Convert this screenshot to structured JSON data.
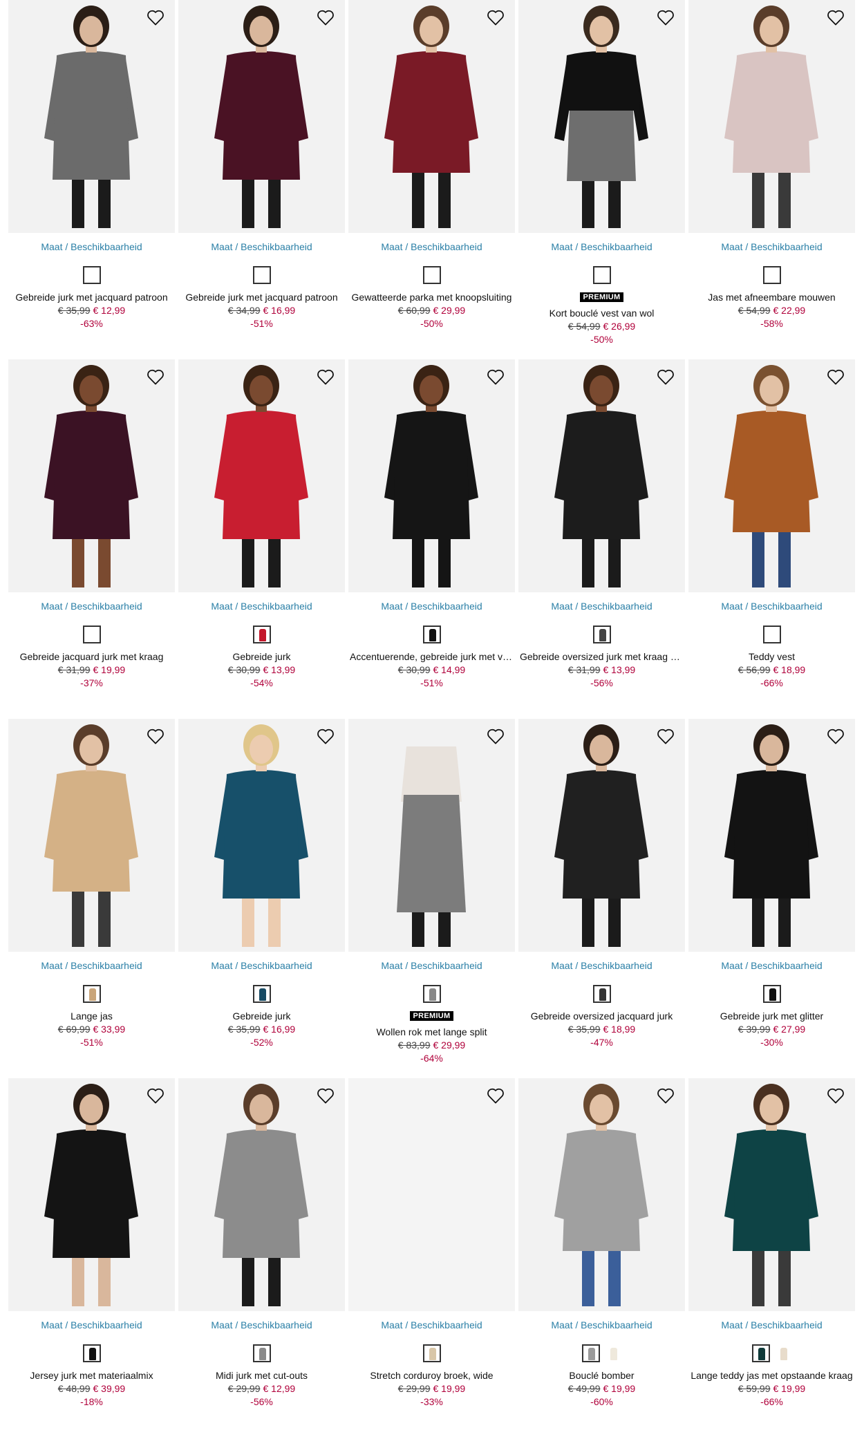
{
  "common": {
    "availability_label": "Maat / Beschikbaarheid"
  },
  "products": [
    {
      "name": "Gebreide jurk met jacquard patroon",
      "old_price": "€ 35,99",
      "new_price": "€ 12,99",
      "discount": "-63%",
      "badge": "",
      "colors": [
        "#ffffff"
      ],
      "figure": {
        "skin": "#d9b79c",
        "hair": "#2b1e16",
        "top": "#6b6b6b",
        "bottom": "#6b6b6b",
        "legs": "#1b1b1b",
        "bg": "#f2f2f2",
        "style": "dress"
      }
    },
    {
      "name": "Gebreide jurk met jacquard patroon",
      "old_price": "€ 34,99",
      "new_price": "€ 16,99",
      "discount": "-51%",
      "badge": "",
      "colors": [
        "#ffffff"
      ],
      "figure": {
        "skin": "#d9b79c",
        "hair": "#2b1e16",
        "top": "#4a1224",
        "bottom": "#4a1224",
        "legs": "#1b1b1b",
        "bg": "#f2f2f2",
        "style": "dress"
      }
    },
    {
      "name": "Gewatteerde parka met knoopsluiting",
      "old_price": "€ 60,99",
      "new_price": "€ 29,99",
      "discount": "-50%",
      "badge": "",
      "colors": [
        "#ffffff"
      ],
      "figure": {
        "skin": "#e2c1a5",
        "hair": "#5a3d2a",
        "top": "#7a1a26",
        "bottom": "#7a1a26",
        "legs": "#1b1b1b",
        "bg": "#f2f2f2",
        "style": "coat"
      }
    },
    {
      "name": "Kort bouclé vest van wol",
      "old_price": "€ 54,99",
      "new_price": "€ 26,99",
      "discount": "-50%",
      "badge": "PREMIUM",
      "colors": [
        "#ffffff"
      ],
      "figure": {
        "skin": "#e2c1a5",
        "hair": "#3a2a1e",
        "top": "#111111",
        "bottom": "#6e6e6e",
        "legs": "#1b1b1b",
        "bg": "#f2f2f2",
        "style": "top"
      }
    },
    {
      "name": "Jas met afneembare mouwen",
      "old_price": "€ 54,99",
      "new_price": "€ 22,99",
      "discount": "-58%",
      "badge": "",
      "colors": [
        "#ffffff"
      ],
      "figure": {
        "skin": "#e2c1a5",
        "hair": "#5a3d2a",
        "top": "#d9c4c2",
        "bottom": "#d9c4c2",
        "legs": "#3a3a3a",
        "bg": "#f2f2f2",
        "style": "coat"
      }
    },
    {
      "name": "Gebreide jacquard jurk met kraag",
      "old_price": "€ 31,99",
      "new_price": "€ 19,99",
      "discount": "-37%",
      "badge": "",
      "colors": [
        "#ffffff"
      ],
      "figure": {
        "skin": "#7a4a30",
        "hair": "#3a2314",
        "top": "#3b1224",
        "bottom": "#3b1224",
        "legs": "#7a4a30",
        "bg": "#f2f2f2",
        "style": "dress"
      }
    },
    {
      "name": "Gebreide jurk",
      "old_price": "€ 30,99",
      "new_price": "€ 13,99",
      "discount": "-54%",
      "badge": "",
      "colors": [
        "#c3162a"
      ],
      "figure": {
        "skin": "#7a4a30",
        "hair": "#3a2314",
        "top": "#c81e30",
        "bottom": "#c81e30",
        "legs": "#1b1b1b",
        "bg": "#f2f2f2",
        "style": "dress"
      }
    },
    {
      "name": "Accentuerende, gebreide jurk met veters",
      "old_price": "€ 30,99",
      "new_price": "€ 14,99",
      "discount": "-51%",
      "badge": "",
      "colors": [
        "#111111"
      ],
      "figure": {
        "skin": "#7a4a30",
        "hair": "#3a2314",
        "top": "#151515",
        "bottom": "#151515",
        "legs": "#151515",
        "bg": "#f2f2f2",
        "style": "dress"
      }
    },
    {
      "name": "Gebreide oversized jurk met kraag en split",
      "old_price": "€ 31,99",
      "new_price": "€ 13,99",
      "discount": "-56%",
      "badge": "",
      "colors": [
        "#444444"
      ],
      "figure": {
        "skin": "#7a4a30",
        "hair": "#3a2314",
        "top": "#1c1c1c",
        "bottom": "#1c1c1c",
        "legs": "#1b1b1b",
        "bg": "#f2f2f2",
        "style": "dress"
      }
    },
    {
      "name": "Teddy vest",
      "old_price": "€ 56,99",
      "new_price": "€ 18,99",
      "discount": "-66%",
      "badge": "",
      "colors": [
        "#ffffff"
      ],
      "figure": {
        "skin": "#e2c1a5",
        "hair": "#7a5130",
        "top": "#a85a25",
        "bottom": "#2e4a7a",
        "legs": "#2e4a7a",
        "bg": "#f2f2f2",
        "style": "coat"
      }
    },
    {
      "name": "Lange jas",
      "old_price": "€ 69,99",
      "new_price": "€ 33,99",
      "discount": "-51%",
      "badge": "",
      "colors": [
        "#c9a57a"
      ],
      "figure": {
        "skin": "#e2c1a5",
        "hair": "#5a3d2a",
        "top": "#d4b186",
        "bottom": "#d4b186",
        "legs": "#3a3a3a",
        "bg": "#f2f2f2",
        "style": "coat"
      }
    },
    {
      "name": "Gebreide jurk",
      "old_price": "€ 35,99",
      "new_price": "€ 16,99",
      "discount": "-52%",
      "badge": "",
      "colors": [
        "#174a63"
      ],
      "figure": {
        "skin": "#ecccb0",
        "hair": "#e0c68a",
        "top": "#17506a",
        "bottom": "#17506a",
        "legs": "#ecccb0",
        "bg": "#f2f2f2",
        "style": "dress"
      }
    },
    {
      "name": "Wollen rok met lange split",
      "old_price": "€ 83,99",
      "new_price": "€ 29,99",
      "discount": "-64%",
      "badge": "PREMIUM",
      "colors": [
        "#888888"
      ],
      "figure": {
        "skin": "#e2c1a5",
        "hair": "#5a3d2a",
        "top": "#e8e2dc",
        "bottom": "#7c7c7c",
        "legs": "#1b1b1b",
        "bg": "#f2f2f2",
        "style": "skirt"
      }
    },
    {
      "name": "Gebreide oversized jacquard jurk",
      "old_price": "€ 35,99",
      "new_price": "€ 18,99",
      "discount": "-47%",
      "badge": "",
      "colors": [
        "#333333"
      ],
      "figure": {
        "skin": "#d9b79c",
        "hair": "#2b1e16",
        "top": "#202020",
        "bottom": "#202020",
        "legs": "#1b1b1b",
        "bg": "#f2f2f2",
        "style": "dress"
      }
    },
    {
      "name": "Gebreide jurk met glitter",
      "old_price": "€ 39,99",
      "new_price": "€ 27,99",
      "discount": "-30%",
      "badge": "",
      "colors": [
        "#111111"
      ],
      "figure": {
        "skin": "#d9b79c",
        "hair": "#2b1e16",
        "top": "#131313",
        "bottom": "#131313",
        "legs": "#1b1b1b",
        "bg": "#f2f2f2",
        "style": "dress"
      }
    },
    {
      "name": "Jersey jurk met materiaalmix",
      "old_price": "€ 48,99",
      "new_price": "€ 39,99",
      "discount": "-18%",
      "badge": "",
      "colors": [
        "#111111"
      ],
      "figure": {
        "skin": "#d9b79c",
        "hair": "#2b1e16",
        "top": "#141414",
        "bottom": "#141414",
        "legs": "#d9b79c",
        "bg": "#f2f2f2",
        "style": "dress"
      }
    },
    {
      "name": "Midi jurk met cut-outs",
      "old_price": "€ 29,99",
      "new_price": "€ 12,99",
      "discount": "-56%",
      "badge": "",
      "colors": [
        "#8a8a8a"
      ],
      "figure": {
        "skin": "#d9b79c",
        "hair": "#5a3d2a",
        "top": "#8c8c8c",
        "bottom": "#8c8c8c",
        "legs": "#1b1b1b",
        "bg": "#f2f2f2",
        "style": "dress"
      }
    },
    {
      "name": "Stretch corduroy broek, wide",
      "old_price": "€ 29,99",
      "new_price": "€ 19,99",
      "discount": "-33%",
      "badge": "",
      "colors": [
        "#d8c6a8"
      ],
      "figure": {
        "skin": "",
        "hair": "",
        "top": "",
        "bottom": "",
        "legs": "",
        "bg": "#f4f4f4",
        "style": "empty"
      }
    },
    {
      "name": "Bouclé bomber",
      "old_price": "€ 49,99",
      "new_price": "€ 19,99",
      "discount": "-60%",
      "badge": "",
      "colors": [
        "#9a9a9a",
        "#efe9dc"
      ],
      "figure": {
        "skin": "#e2c1a5",
        "hair": "#6a4a30",
        "top": "#a0a0a0",
        "bottom": "#3b5f9a",
        "legs": "#3b5f9a",
        "bg": "#f2f2f2",
        "style": "coat"
      }
    },
    {
      "name": "Lange teddy jas met opstaande kraag",
      "old_price": "€ 59,99",
      "new_price": "€ 19,99",
      "discount": "-66%",
      "badge": "",
      "colors": [
        "#0f3b3a",
        "#e8dccb"
      ],
      "figure": {
        "skin": "#e2c1a5",
        "hair": "#4a3020",
        "top": "#0e4345",
        "bottom": "#0e4345",
        "legs": "#3a3a3a",
        "bg": "#f2f2f2",
        "style": "coat"
      }
    }
  ]
}
